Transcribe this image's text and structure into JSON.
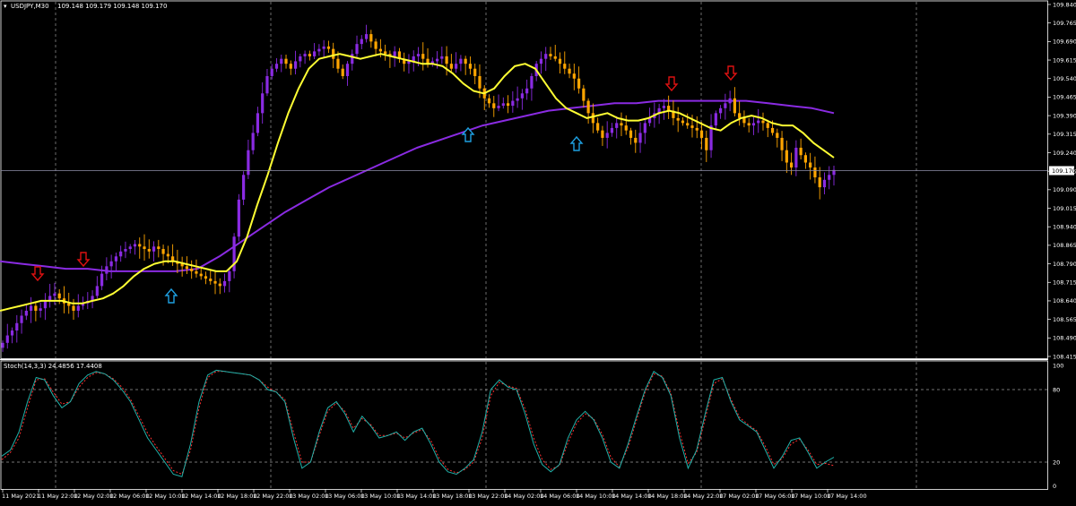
{
  "header": {
    "symbol_timeframe": "USDJPY,M30",
    "ohlc": "109.148 109.179 109.148 109.170"
  },
  "chart_data": [
    {
      "type": "candlestick",
      "title": "USDJPY,M30",
      "ylim": [
        108.415,
        109.84
      ],
      "grid": true,
      "price_ticks": [
        "109.840",
        "109.765",
        "109.690",
        "109.615",
        "109.540",
        "109.465",
        "109.390",
        "109.315",
        "109.240",
        "109.165",
        "109.090",
        "109.015",
        "108.940",
        "108.865",
        "108.790",
        "108.715",
        "108.640",
        "108.565",
        "108.490",
        "108.415"
      ],
      "current_price": "109.170",
      "colors": {
        "bull": "#8a2be2",
        "bear": "#ffa500",
        "ma_fast": "#ffff33",
        "ma_slow": "#8a2be2",
        "arrow_sell": "#dd1111",
        "arrow_buy": "#1e9fe0"
      },
      "closes": [
        108.47,
        108.5,
        108.52,
        108.55,
        108.58,
        108.6,
        108.62,
        108.6,
        108.61,
        108.64,
        108.66,
        108.67,
        108.65,
        108.63,
        108.62,
        108.6,
        108.62,
        108.63,
        108.64,
        108.66,
        108.7,
        108.75,
        108.78,
        108.8,
        108.82,
        108.84,
        108.85,
        108.86,
        108.87,
        108.86,
        108.85,
        108.84,
        108.86,
        108.85,
        108.83,
        108.82,
        108.8,
        108.79,
        108.78,
        108.77,
        108.76,
        108.75,
        108.74,
        108.73,
        108.72,
        108.71,
        108.7,
        108.72,
        108.76,
        108.9,
        109.05,
        109.15,
        109.25,
        109.32,
        109.4,
        109.48,
        109.55,
        109.58,
        109.6,
        109.62,
        109.6,
        109.58,
        109.61,
        109.63,
        109.64,
        109.63,
        109.65,
        109.66,
        109.67,
        109.66,
        109.62,
        109.58,
        109.55,
        109.6,
        109.64,
        109.68,
        109.7,
        109.72,
        109.69,
        109.66,
        109.65,
        109.64,
        109.63,
        109.65,
        109.62,
        109.6,
        109.61,
        109.63,
        109.64,
        109.62,
        109.6,
        109.61,
        109.62,
        109.63,
        109.6,
        109.58,
        109.6,
        109.62,
        109.6,
        109.58,
        109.55,
        109.5,
        109.46,
        109.44,
        109.42,
        109.43,
        109.44,
        109.43,
        109.45,
        109.46,
        109.48,
        109.5,
        109.55,
        109.6,
        109.62,
        109.64,
        109.63,
        109.62,
        109.6,
        109.58,
        109.56,
        109.54,
        109.5,
        109.45,
        109.4,
        109.36,
        109.33,
        109.3,
        109.32,
        109.34,
        109.36,
        109.35,
        109.33,
        109.3,
        109.28,
        109.32,
        109.36,
        109.38,
        109.4,
        109.42,
        109.43,
        109.41,
        109.38,
        109.37,
        109.36,
        109.35,
        109.34,
        109.33,
        109.3,
        109.25,
        109.35,
        109.4,
        109.42,
        109.44,
        109.46,
        109.4,
        109.38,
        109.36,
        109.35,
        109.36,
        109.37,
        109.36,
        109.34,
        109.32,
        109.3,
        109.25,
        109.2,
        109.18,
        109.26,
        109.23,
        109.2,
        109.18,
        109.14,
        109.1,
        109.13,
        109.15,
        109.17
      ],
      "ma_fast": [
        108.6,
        108.61,
        108.62,
        108.63,
        108.64,
        108.64,
        108.64,
        108.63,
        108.63,
        108.64,
        108.65,
        108.67,
        108.7,
        108.74,
        108.77,
        108.79,
        108.8,
        108.8,
        108.79,
        108.78,
        108.77,
        108.76,
        108.76,
        108.8,
        108.9,
        109.03,
        109.15,
        109.28,
        109.4,
        109.5,
        109.58,
        109.62,
        109.63,
        109.64,
        109.63,
        109.62,
        109.63,
        109.64,
        109.63,
        109.62,
        109.61,
        109.6,
        109.6,
        109.59,
        109.56,
        109.52,
        109.49,
        109.48,
        109.5,
        109.55,
        109.59,
        109.6,
        109.58,
        109.52,
        109.46,
        109.42,
        109.4,
        109.38,
        109.39,
        109.4,
        109.38,
        109.37,
        109.37,
        109.38,
        109.4,
        109.41,
        109.4,
        109.38,
        109.36,
        109.34,
        109.33,
        109.36,
        109.38,
        109.39,
        109.38,
        109.36,
        109.35,
        109.35,
        109.32,
        109.28,
        109.25,
        109.22
      ],
      "ma_slow": [
        108.8,
        108.79,
        108.78,
        108.77,
        108.77,
        108.76,
        108.76,
        108.76,
        108.76,
        108.77,
        108.82,
        108.88,
        108.94,
        109.0,
        109.05,
        109.1,
        109.14,
        109.18,
        109.22,
        109.26,
        109.29,
        109.32,
        109.35,
        109.37,
        109.39,
        109.41,
        109.42,
        109.43,
        109.44,
        109.44,
        109.45,
        109.45,
        109.45,
        109.45,
        109.45,
        109.44,
        109.43,
        109.42,
        109.4
      ],
      "sell_arrows": [
        "11 May 2021 +3h",
        "12 May 2021 ~00:00",
        "14 May 2021 ~18:00",
        "17 May 2021 ~02:00"
      ],
      "buy_arrows": [
        "12 May 2021 ~10:00",
        "13 May 2021 ~22:00",
        "14 May 2021 ~06:00"
      ]
    },
    {
      "type": "line",
      "title": "Stoch(14,3,3) 24.4856 17.4408",
      "ylim": [
        0,
        100
      ],
      "levels": [
        20,
        80
      ],
      "y_ticks": [
        "100",
        "80",
        "20",
        "0"
      ],
      "colors": {
        "main": "#20b2aa",
        "signal": "#ff3030"
      },
      "main": [
        25,
        30,
        45,
        70,
        90,
        88,
        75,
        65,
        70,
        85,
        92,
        95,
        93,
        88,
        80,
        70,
        55,
        40,
        30,
        20,
        10,
        8,
        35,
        70,
        92,
        96,
        95,
        94,
        93,
        92,
        88,
        80,
        78,
        70,
        40,
        15,
        20,
        45,
        65,
        70,
        60,
        45,
        58,
        50,
        40,
        42,
        45,
        38,
        45,
        48,
        35,
        20,
        12,
        10,
        15,
        22,
        45,
        80,
        88,
        82,
        80,
        60,
        35,
        18,
        12,
        18,
        40,
        55,
        62,
        55,
        40,
        20,
        15,
        35,
        58,
        80,
        95,
        90,
        75,
        40,
        15,
        30,
        60,
        88,
        90,
        70,
        55,
        50,
        45,
        30,
        15,
        25,
        38,
        40,
        28,
        15,
        20,
        24
      ],
      "signal": [
        22,
        28,
        40,
        65,
        88,
        89,
        78,
        68,
        70,
        82,
        90,
        94,
        93,
        89,
        82,
        72,
        58,
        44,
        33,
        23,
        13,
        10,
        30,
        65,
        90,
        95,
        95,
        94,
        93,
        92,
        88,
        82,
        78,
        72,
        45,
        20,
        20,
        42,
        62,
        69,
        62,
        48,
        56,
        51,
        42,
        42,
        44,
        40,
        44,
        47,
        38,
        23,
        14,
        11,
        14,
        20,
        40,
        75,
        86,
        83,
        81,
        64,
        40,
        22,
        14,
        17,
        36,
        52,
        60,
        56,
        43,
        24,
        16,
        32,
        55,
        78,
        93,
        91,
        77,
        45,
        19,
        28,
        56,
        85,
        89,
        72,
        57,
        51,
        46,
        33,
        18,
        23,
        35,
        39,
        30,
        18,
        19,
        17
      ]
    }
  ],
  "x_axis_labels": [
    "11 May 2021",
    "11 May 22:00",
    "12 May 02:00",
    "12 May 06:00",
    "12 May 10:00",
    "12 May 14:00",
    "12 May 18:00",
    "12 May 22:00",
    "13 May 02:00",
    "13 May 06:00",
    "13 May 10:00",
    "13 May 14:00",
    "13 May 18:00",
    "13 May 22:00",
    "14 May 02:00",
    "14 May 06:00",
    "14 May 10:00",
    "14 May 14:00",
    "14 May 18:00",
    "14 May 22:00",
    "17 May 02:00",
    "17 May 06:00",
    "17 May 10:00",
    "17 May 14:00"
  ]
}
